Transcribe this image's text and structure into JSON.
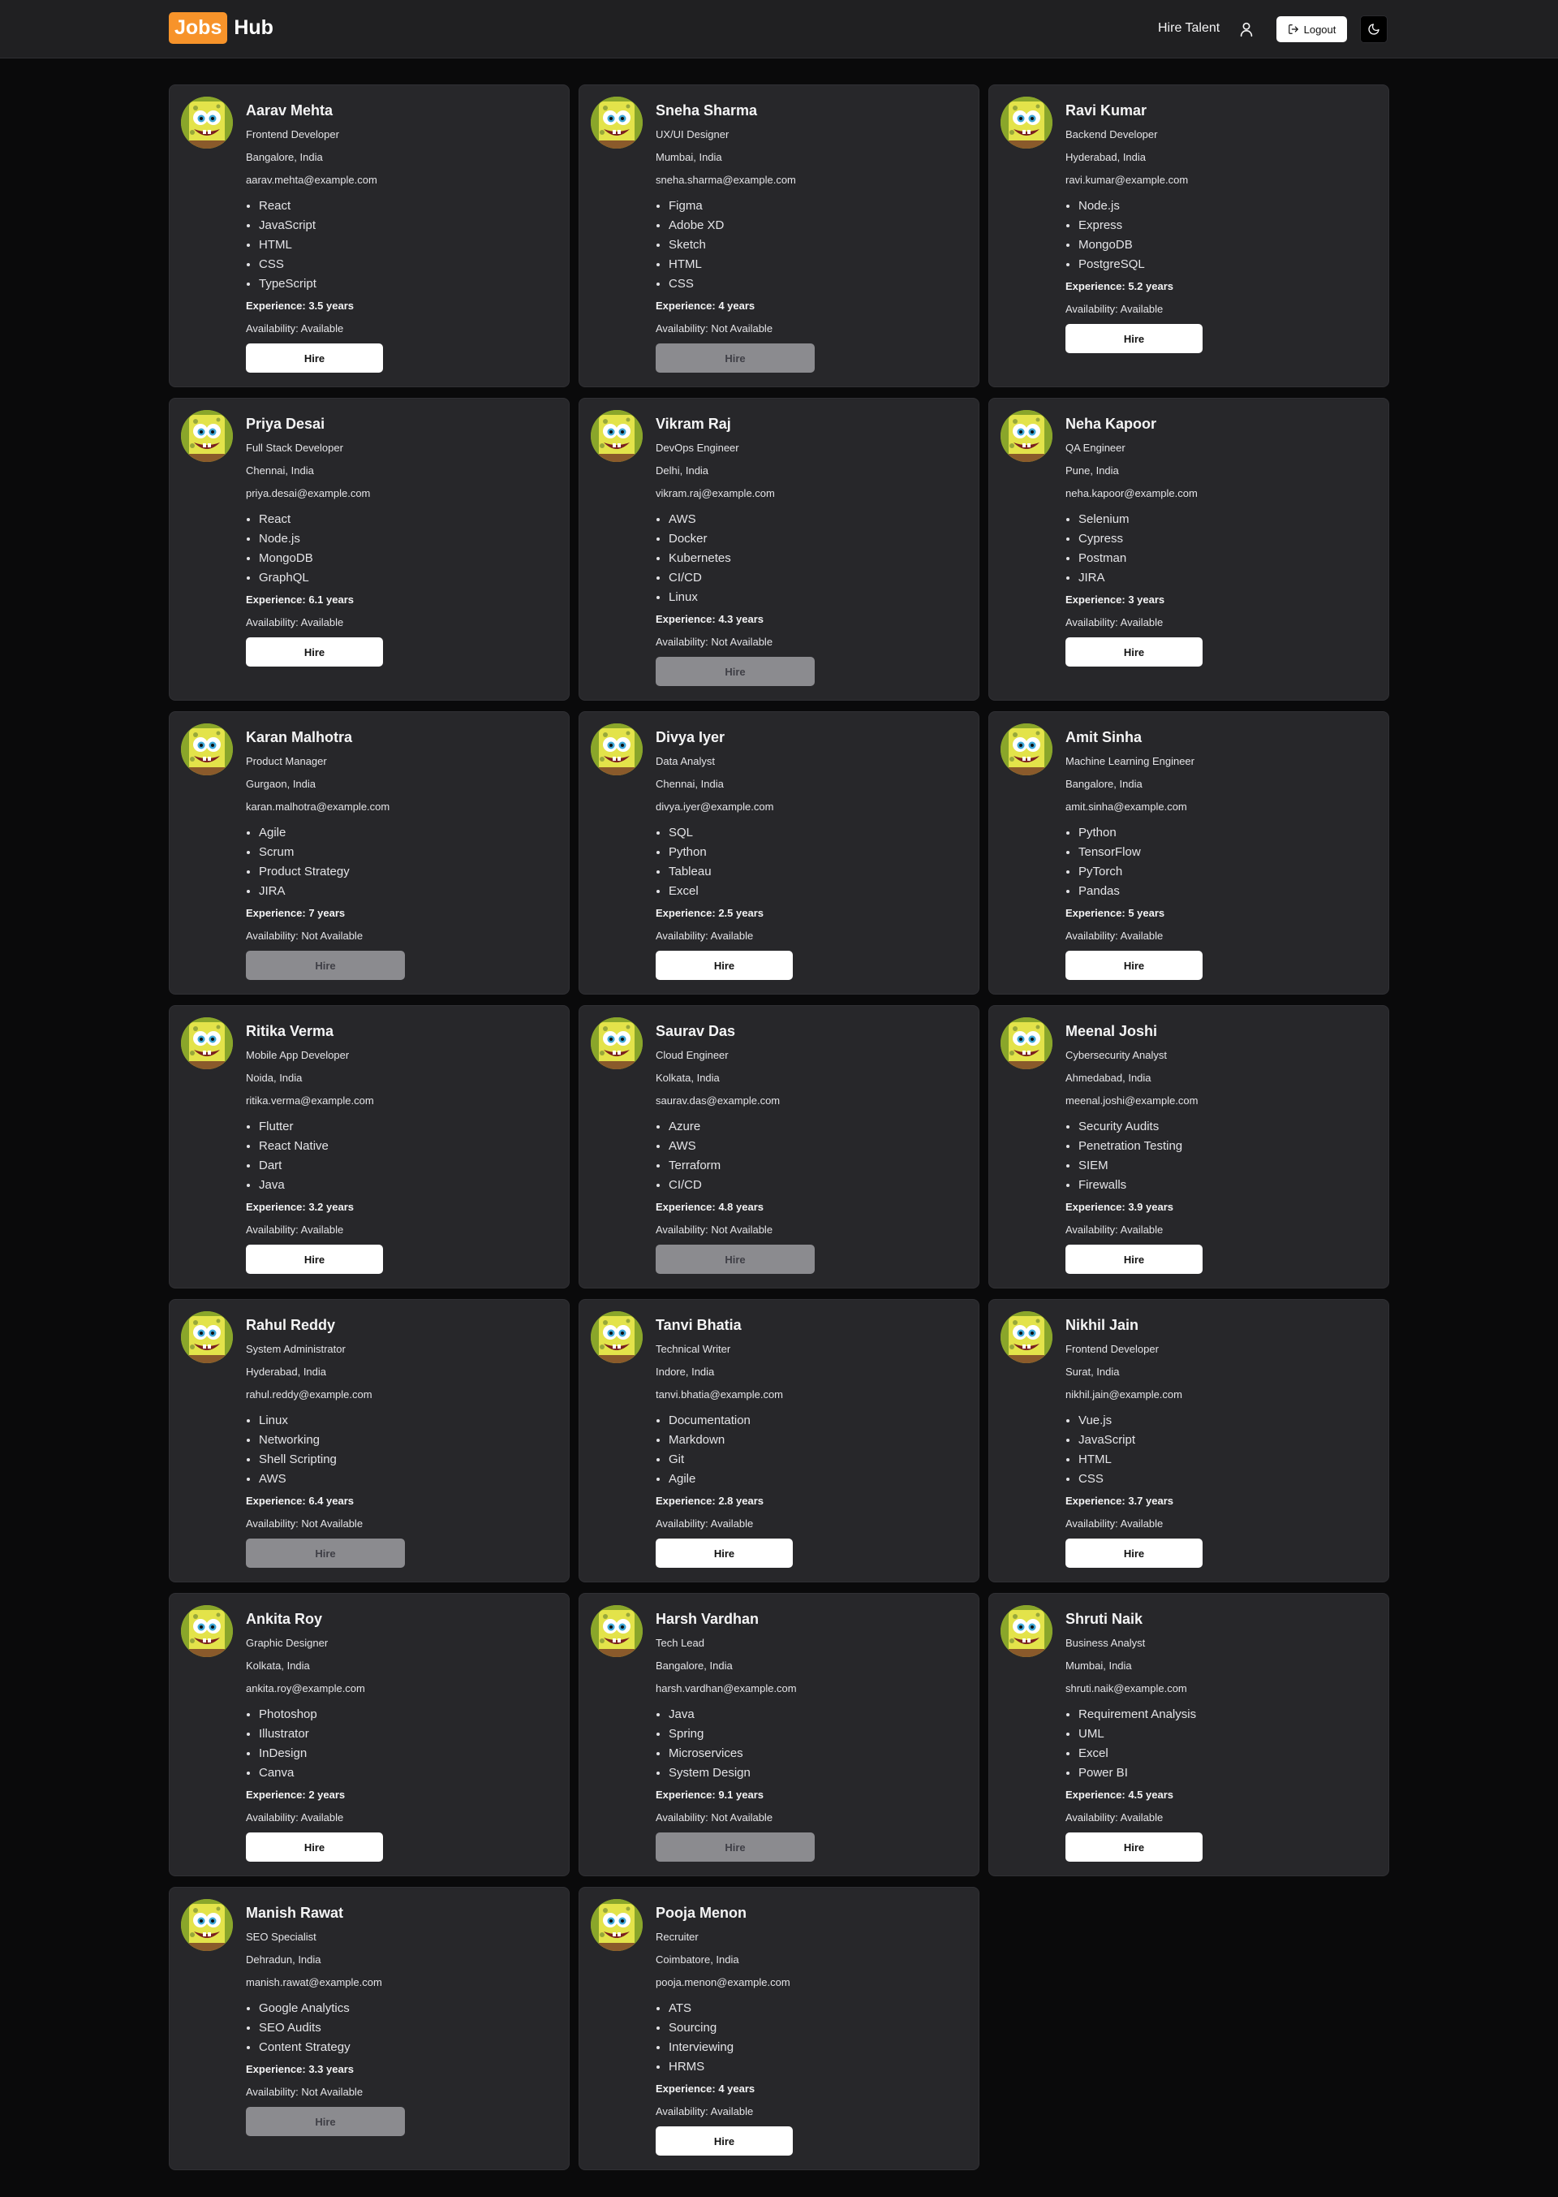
{
  "header": {
    "logo_badge": "Jobs",
    "logo_text": "Hub",
    "nav_link": "Hire Talent",
    "logout_label": "Logout"
  },
  "hire_label": "Hire",
  "experience_prefix": "Experience: ",
  "availability_prefix": "Availability: ",
  "candidates": [
    {
      "name": "Aarav Mehta",
      "role": "Frontend Developer",
      "location": "Bangalore, India",
      "email": "aarav.mehta@example.com",
      "skills": [
        "React",
        "JavaScript",
        "HTML",
        "CSS",
        "TypeScript"
      ],
      "experience": "3.5 years",
      "availability": "Available"
    },
    {
      "name": "Sneha Sharma",
      "role": "UX/UI Designer",
      "location": "Mumbai, India",
      "email": "sneha.sharma@example.com",
      "skills": [
        "Figma",
        "Adobe XD",
        "Sketch",
        "HTML",
        "CSS"
      ],
      "experience": "4 years",
      "availability": "Not Available"
    },
    {
      "name": "Ravi Kumar",
      "role": "Backend Developer",
      "location": "Hyderabad, India",
      "email": "ravi.kumar@example.com",
      "skills": [
        "Node.js",
        "Express",
        "MongoDB",
        "PostgreSQL"
      ],
      "experience": "5.2 years",
      "availability": "Available"
    },
    {
      "name": "Priya Desai",
      "role": "Full Stack Developer",
      "location": "Chennai, India",
      "email": "priya.desai@example.com",
      "skills": [
        "React",
        "Node.js",
        "MongoDB",
        "GraphQL"
      ],
      "experience": "6.1 years",
      "availability": "Available"
    },
    {
      "name": "Vikram Raj",
      "role": "DevOps Engineer",
      "location": "Delhi, India",
      "email": "vikram.raj@example.com",
      "skills": [
        "AWS",
        "Docker",
        "Kubernetes",
        "CI/CD",
        "Linux"
      ],
      "experience": "4.3 years",
      "availability": "Not Available"
    },
    {
      "name": "Neha Kapoor",
      "role": "QA Engineer",
      "location": "Pune, India",
      "email": "neha.kapoor@example.com",
      "skills": [
        "Selenium",
        "Cypress",
        "Postman",
        "JIRA"
      ],
      "experience": "3 years",
      "availability": "Available"
    },
    {
      "name": "Karan Malhotra",
      "role": "Product Manager",
      "location": "Gurgaon, India",
      "email": "karan.malhotra@example.com",
      "skills": [
        "Agile",
        "Scrum",
        "Product Strategy",
        "JIRA"
      ],
      "experience": "7 years",
      "availability": "Not Available"
    },
    {
      "name": "Divya Iyer",
      "role": "Data Analyst",
      "location": "Chennai, India",
      "email": "divya.iyer@example.com",
      "skills": [
        "SQL",
        "Python",
        "Tableau",
        "Excel"
      ],
      "experience": "2.5 years",
      "availability": "Available"
    },
    {
      "name": "Amit Sinha",
      "role": "Machine Learning Engineer",
      "location": "Bangalore, India",
      "email": "amit.sinha@example.com",
      "skills": [
        "Python",
        "TensorFlow",
        "PyTorch",
        "Pandas"
      ],
      "experience": "5 years",
      "availability": "Available"
    },
    {
      "name": "Ritika Verma",
      "role": "Mobile App Developer",
      "location": "Noida, India",
      "email": "ritika.verma@example.com",
      "skills": [
        "Flutter",
        "React Native",
        "Dart",
        "Java"
      ],
      "experience": "3.2 years",
      "availability": "Available"
    },
    {
      "name": "Saurav Das",
      "role": "Cloud Engineer",
      "location": "Kolkata, India",
      "email": "saurav.das@example.com",
      "skills": [
        "Azure",
        "AWS",
        "Terraform",
        "CI/CD"
      ],
      "experience": "4.8 years",
      "availability": "Not Available"
    },
    {
      "name": "Meenal Joshi",
      "role": "Cybersecurity Analyst",
      "location": "Ahmedabad, India",
      "email": "meenal.joshi@example.com",
      "skills": [
        "Security Audits",
        "Penetration Testing",
        "SIEM",
        "Firewalls"
      ],
      "experience": "3.9 years",
      "availability": "Available"
    },
    {
      "name": "Rahul Reddy",
      "role": "System Administrator",
      "location": "Hyderabad, India",
      "email": "rahul.reddy@example.com",
      "skills": [
        "Linux",
        "Networking",
        "Shell Scripting",
        "AWS"
      ],
      "experience": "6.4 years",
      "availability": "Not Available"
    },
    {
      "name": "Tanvi Bhatia",
      "role": "Technical Writer",
      "location": "Indore, India",
      "email": "tanvi.bhatia@example.com",
      "skills": [
        "Documentation",
        "Markdown",
        "Git",
        "Agile"
      ],
      "experience": "2.8 years",
      "availability": "Available"
    },
    {
      "name": "Nikhil Jain",
      "role": "Frontend Developer",
      "location": "Surat, India",
      "email": "nikhil.jain@example.com",
      "skills": [
        "Vue.js",
        "JavaScript",
        "HTML",
        "CSS"
      ],
      "experience": "3.7 years",
      "availability": "Available"
    },
    {
      "name": "Ankita Roy",
      "role": "Graphic Designer",
      "location": "Kolkata, India",
      "email": "ankita.roy@example.com",
      "skills": [
        "Photoshop",
        "Illustrator",
        "InDesign",
        "Canva"
      ],
      "experience": "2 years",
      "availability": "Available"
    },
    {
      "name": "Harsh Vardhan",
      "role": "Tech Lead",
      "location": "Bangalore, India",
      "email": "harsh.vardhan@example.com",
      "skills": [
        "Java",
        "Spring",
        "Microservices",
        "System Design"
      ],
      "experience": "9.1 years",
      "availability": "Not Available"
    },
    {
      "name": "Shruti Naik",
      "role": "Business Analyst",
      "location": "Mumbai, India",
      "email": "shruti.naik@example.com",
      "skills": [
        "Requirement Analysis",
        "UML",
        "Excel",
        "Power BI"
      ],
      "experience": "4.5 years",
      "availability": "Available"
    },
    {
      "name": "Manish Rawat",
      "role": "SEO Specialist",
      "location": "Dehradun, India",
      "email": "manish.rawat@example.com",
      "skills": [
        "Google Analytics",
        "SEO Audits",
        "Content Strategy"
      ],
      "experience": "3.3 years",
      "availability": "Not Available"
    },
    {
      "name": "Pooja Menon",
      "role": "Recruiter",
      "location": "Coimbatore, India",
      "email": "pooja.menon@example.com",
      "skills": [
        "ATS",
        "Sourcing",
        "Interviewing",
        "HRMS"
      ],
      "experience": "4 years",
      "availability": "Available"
    }
  ]
}
